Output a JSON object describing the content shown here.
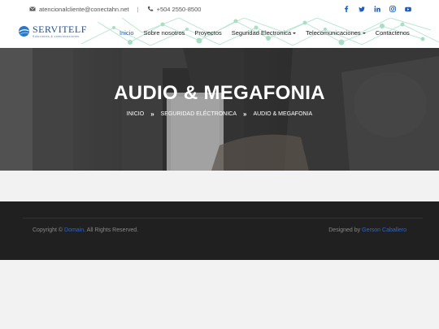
{
  "topbar": {
    "email": "atencionalcliente@conectahn.net",
    "separator": "|",
    "phone": "+504 2550-8500",
    "social": [
      "facebook-icon",
      "twitter-icon",
      "linkedin-icon",
      "instagram-icon",
      "youtube-icon"
    ]
  },
  "logo": {
    "brand": "SERVITELF",
    "tagline": "Soluciones & comunicaciones"
  },
  "nav": {
    "items": [
      {
        "label": "Inicio",
        "active": true
      },
      {
        "label": "Sobre nosotros"
      },
      {
        "label": "Proyectos"
      },
      {
        "label": "Seguridad Electronica",
        "dropdown": true
      },
      {
        "label": "Telecomunicaciones",
        "dropdown": true
      },
      {
        "label": "Contactenos"
      }
    ]
  },
  "hero": {
    "title": "AUDIO & MEGAFONIA",
    "breadcrumb": [
      "INICIO",
      "SEGURIDAD ELÉCTRONICA",
      "AUDIO & MEGAFONIA"
    ]
  },
  "footer": {
    "copyright_prefix": "Copyright ©",
    "copyright_link": "Domain",
    "copyright_suffix": ". All Rights Reserved.",
    "designed_prefix": "Designed by",
    "designer": "Gerson Caballero"
  },
  "colors": {
    "accent": "#1e5dbc",
    "footer_bg": "#202020",
    "page_bg": "#f2f2f2"
  }
}
